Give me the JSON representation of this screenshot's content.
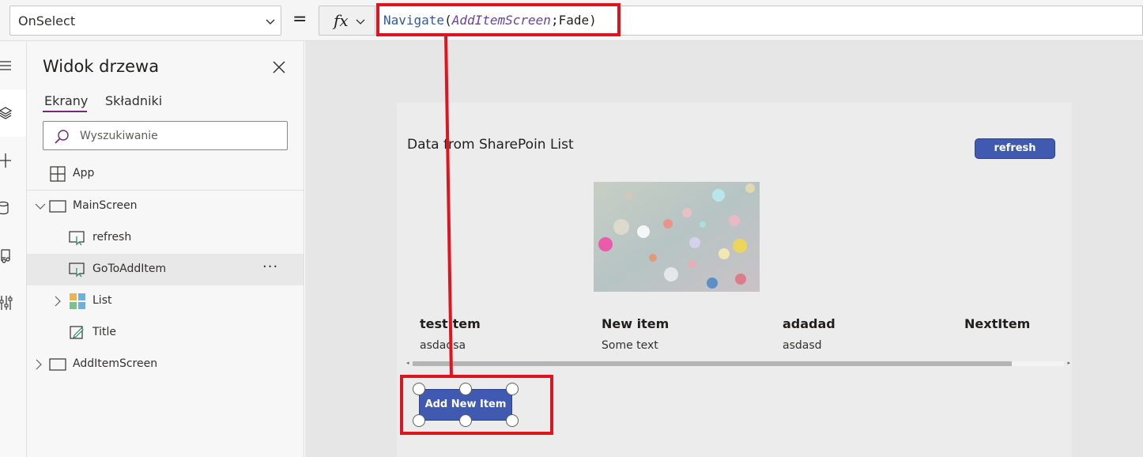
{
  "formula_bar": {
    "property": "OnSelect",
    "equals": "=",
    "fx_label": "fx",
    "formula": {
      "fn": "Navigate",
      "open": "(",
      "arg1": "AddItemScreen",
      "sep": ";",
      "arg2": "Fade",
      "close": ")"
    }
  },
  "rail": {
    "icons": [
      "hamburger-icon",
      "layers-icon",
      "plus-icon",
      "database-icon",
      "media-icon",
      "tools-icon"
    ]
  },
  "tree_view": {
    "title": "Widok drzewa",
    "tabs": [
      "Ekrany",
      "Składniki"
    ],
    "active_tab": "Ekrany",
    "search_placeholder": "Wyszukiwanie",
    "app_label": "App",
    "items": [
      {
        "label": "MainScreen",
        "type": "screen",
        "expanded": true
      },
      {
        "label": "refresh",
        "type": "button"
      },
      {
        "label": "GoToAddItem",
        "type": "button",
        "selected": true,
        "more": "···"
      },
      {
        "label": "List",
        "type": "gallery",
        "expanded": false
      },
      {
        "label": "Title",
        "type": "label"
      },
      {
        "label": "AddItemScreen",
        "type": "screen",
        "expanded": false
      }
    ]
  },
  "canvas": {
    "title": "Data from SharePoin List",
    "refresh_button": "refresh",
    "gallery": [
      {
        "title": "testItem",
        "subtitle": "asdadsa"
      },
      {
        "title": "New item",
        "subtitle": "Some text"
      },
      {
        "title": "adadad",
        "subtitle": "asdasd"
      },
      {
        "title": "NextItem",
        "subtitle": ""
      }
    ],
    "scroll_position": 0.92,
    "add_button": "Add New Item"
  },
  "colors": {
    "accent_purple": "#742774",
    "button_blue": "#3f5ab0",
    "annotation_red": "#e0141e"
  }
}
